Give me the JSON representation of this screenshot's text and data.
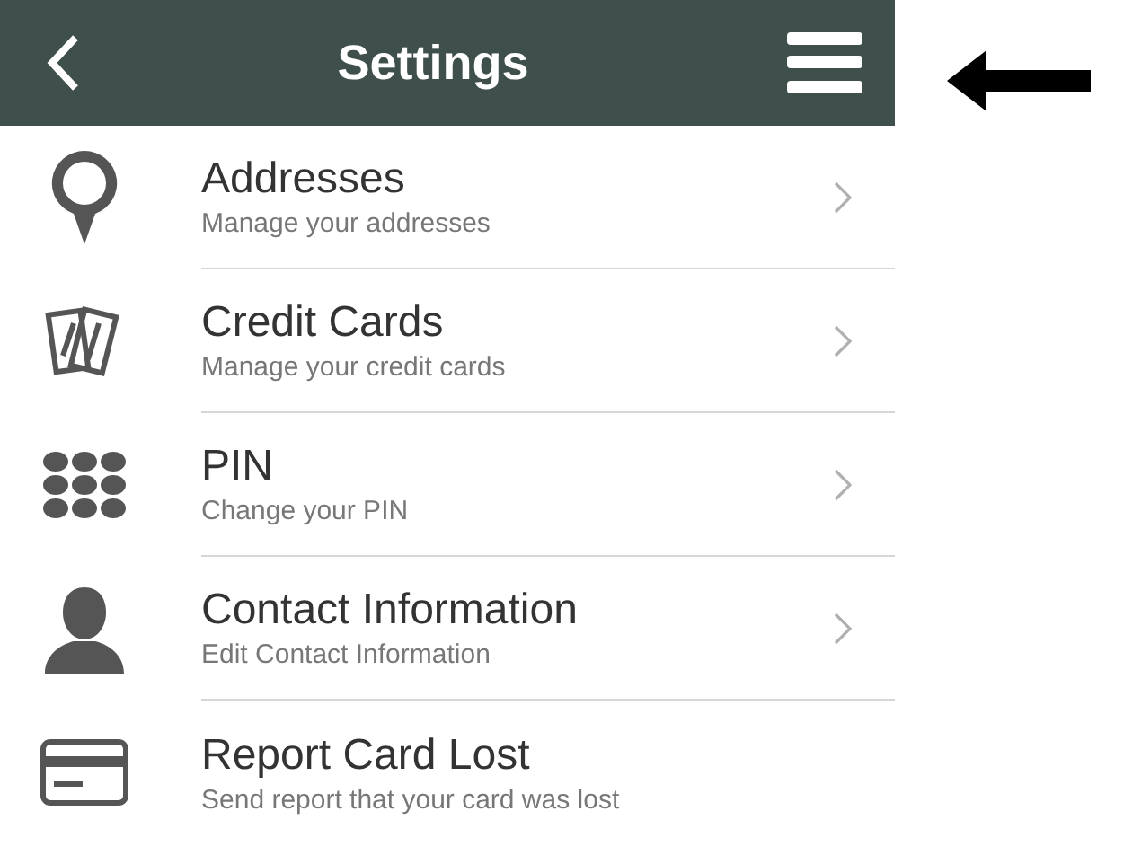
{
  "header": {
    "title": "Settings"
  },
  "items": [
    {
      "kind": "pin",
      "title": "Addresses",
      "subtitle": "Manage your addresses",
      "chevron": true
    },
    {
      "kind": "cards",
      "title": "Credit Cards",
      "subtitle": "Manage your credit cards",
      "chevron": true
    },
    {
      "kind": "keypad",
      "title": "PIN",
      "subtitle": "Change your PIN",
      "chevron": true
    },
    {
      "kind": "person",
      "title": "Contact Information",
      "subtitle": "Edit Contact Information",
      "chevron": true
    },
    {
      "kind": "card",
      "title": "Report Card Lost",
      "subtitle": "Send report that your card was lost",
      "chevron": false
    }
  ]
}
